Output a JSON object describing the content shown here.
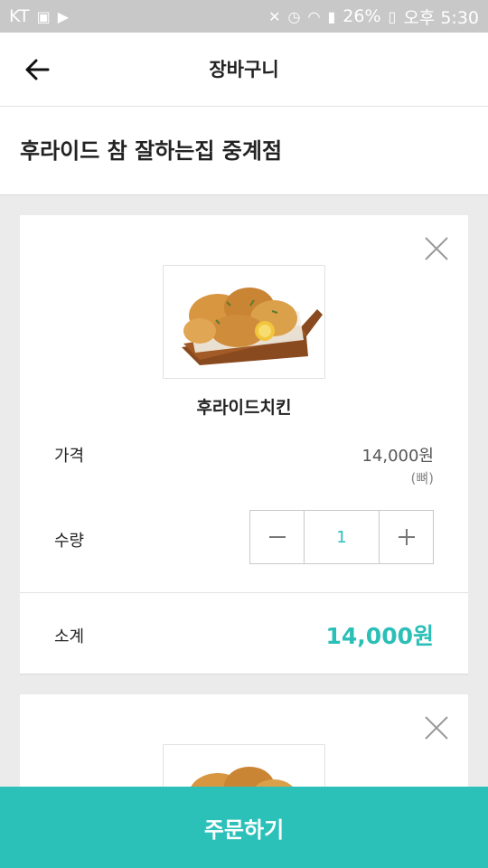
{
  "status_bar": {
    "carrier": "KT",
    "battery": "26%",
    "time": "오후 5:30",
    "icons": [
      "image-icon",
      "play-store-icon",
      "mute-icon",
      "alarm-icon",
      "hd-icon",
      "wifi-icon",
      "signal-icon",
      "battery-icon"
    ]
  },
  "header": {
    "title": "장바구니",
    "back_icon": "back-arrow-icon"
  },
  "store": {
    "name": "후라이드 참 잘하는집 중계점"
  },
  "cart_items": [
    {
      "name": "후라이드치킨",
      "price_label": "가격",
      "price": "14,000원",
      "option": "(뼈)",
      "quantity_label": "수량",
      "quantity": "1",
      "subtotal_label": "소계",
      "subtotal": "14,000원",
      "image_alt": "fried-chicken-image"
    },
    {
      "image_alt": "fried-chicken-image"
    }
  ],
  "footer": {
    "order_label": "주문하기"
  },
  "colors": {
    "accent": "#2bc1b9",
    "accent_text": "#2bbfb8",
    "background": "#ebebeb",
    "status_bar": "#c8c8c8"
  }
}
